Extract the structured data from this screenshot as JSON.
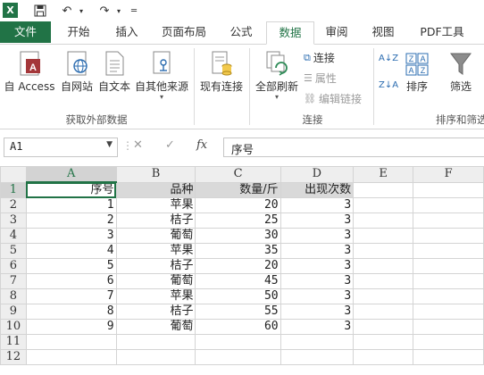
{
  "app": {
    "logo_text": "X"
  },
  "tabs": [
    {
      "label": "文件"
    },
    {
      "label": "开始"
    },
    {
      "label": "插入"
    },
    {
      "label": "页面布局"
    },
    {
      "label": "公式"
    },
    {
      "label": "数据"
    },
    {
      "label": "审阅"
    },
    {
      "label": "视图"
    },
    {
      "label": "PDF工具"
    }
  ],
  "ribbon": {
    "get_external": {
      "access": "自 Access",
      "web": "自网站",
      "text": "自文本",
      "other": "自其他来源",
      "group_label": "获取外部数据"
    },
    "existing_conn": "现有连接",
    "connections": {
      "refresh_all": "全部刷新",
      "connections": "连接",
      "properties": "属性",
      "edit_links": "编辑链接",
      "group_label": "连接"
    },
    "sort_filter": {
      "sort": "排序",
      "filter": "筛选",
      "group_label": "排序和筛选"
    }
  },
  "formula_bar": {
    "name_box": "A1",
    "formula": "序号"
  },
  "columns": [
    "A",
    "B",
    "C",
    "D",
    "E",
    "F"
  ],
  "rows": [
    {
      "n": "1",
      "a": "序号",
      "b": "品种",
      "c": "数量/斤",
      "d": "出现次数"
    },
    {
      "n": "2",
      "a": "1",
      "b": "苹果",
      "c": "20",
      "d": "3"
    },
    {
      "n": "3",
      "a": "2",
      "b": "桔子",
      "c": "25",
      "d": "3"
    },
    {
      "n": "4",
      "a": "3",
      "b": "葡萄",
      "c": "30",
      "d": "3"
    },
    {
      "n": "5",
      "a": "4",
      "b": "苹果",
      "c": "35",
      "d": "3"
    },
    {
      "n": "6",
      "a": "5",
      "b": "桔子",
      "c": "20",
      "d": "3"
    },
    {
      "n": "7",
      "a": "6",
      "b": "葡萄",
      "c": "45",
      "d": "3"
    },
    {
      "n": "8",
      "a": "7",
      "b": "苹果",
      "c": "50",
      "d": "3"
    },
    {
      "n": "9",
      "a": "8",
      "b": "桔子",
      "c": "55",
      "d": "3"
    },
    {
      "n": "10",
      "a": "9",
      "b": "葡萄",
      "c": "60",
      "d": "3"
    },
    {
      "n": "11",
      "a": "",
      "b": "",
      "c": "",
      "d": ""
    },
    {
      "n": "12",
      "a": "",
      "b": "",
      "c": "",
      "d": ""
    }
  ]
}
